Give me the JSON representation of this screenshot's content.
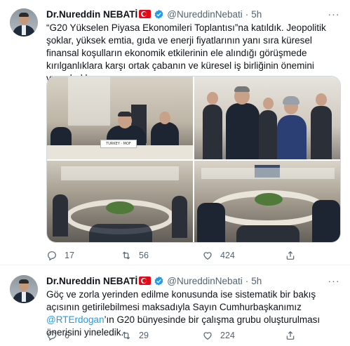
{
  "tweets": [
    {
      "author": {
        "name": "Dr.Nureddin NEBATİ",
        "handle": "@NureddinNebati",
        "time": "5h",
        "separator": "·"
      },
      "text": "“G20 Yükselen Piyasa Ekonomileri Toplantısı”na katıldık. Jeopolitik şoklar, yüksek emtia, gıda ve enerji fiyatlarının yanı sıra küresel finansal koşulların ekonomik etkilerinin ele alındığı görüşmede kırılganlıklara karşı ortak çabanın ve küresel iş birliğinin önemini vurguladık.",
      "nameplate": "TURKEY · MOF",
      "stats": {
        "replies": "17",
        "retweets": "56",
        "likes": "424"
      }
    },
    {
      "author": {
        "name": "Dr.Nureddin NEBATİ",
        "handle": "@NureddinNebati",
        "time": "5h",
        "separator": "·"
      },
      "text_before": "Göç ve zorla yerinden edilme konusunda ise sistematik bir bakış açısının getirilebilmesi maksadıyla Sayın Cumhurbaşkanımız ",
      "mention": "@RTErdogan",
      "text_after": "’ın G20 bünyesinde bir çalışma grubu oluşturulması önerisini yineledik.",
      "stats": {
        "replies": "6",
        "retweets": "29",
        "likes": "224"
      }
    }
  ],
  "colors": {
    "accent": "#1d9bf0",
    "flag": "#e30a17",
    "muted": "#536471",
    "text": "#0f1419"
  },
  "icons": [
    "verified-badge-icon",
    "turkey-flag-icon",
    "more-icon",
    "reply-icon",
    "retweet-icon",
    "like-icon",
    "share-icon"
  ]
}
